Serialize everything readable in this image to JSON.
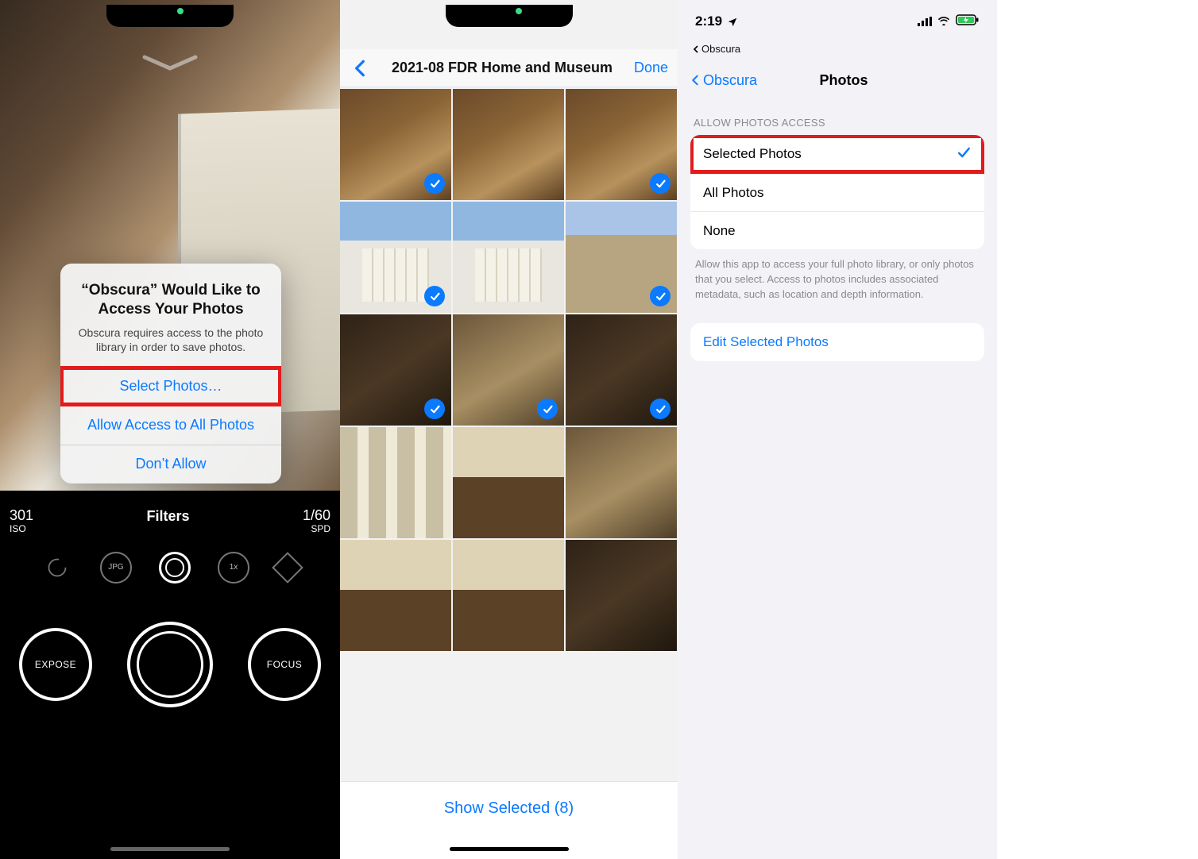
{
  "left": {
    "alert": {
      "title": "“Obscura” Would Like to Access Your Photos",
      "subtitle": "Obscura requires access to the photo library in order to save photos.",
      "buttons": {
        "select": "Select Photos…",
        "allow_all": "Allow Access to All Photos",
        "deny": "Don’t Allow"
      }
    },
    "hud": {
      "iso_value": "301",
      "iso_label": "ISO",
      "center_title": "Filters",
      "spd_value": "1/60",
      "spd_label": "SPD",
      "format_label": "JPG",
      "zoom_label": "1x",
      "expose_label": "EXPOSE",
      "focus_label": "FOCUS"
    }
  },
  "mid": {
    "album_title": "2021-08 FDR Home and Museum",
    "done_label": "Done",
    "show_selected_label": "Show Selected (8)",
    "selected_count": 8,
    "thumbs": [
      {
        "cls": "bronze",
        "selected": true
      },
      {
        "cls": "bronze",
        "selected": false
      },
      {
        "cls": "bronze",
        "selected": true
      },
      {
        "cls": "bldg",
        "selected": true
      },
      {
        "cls": "bldg",
        "selected": false
      },
      {
        "cls": "stone",
        "selected": true
      },
      {
        "cls": "interior-dark",
        "selected": true
      },
      {
        "cls": "interior-warm",
        "selected": true
      },
      {
        "cls": "interior-dark",
        "selected": true
      },
      {
        "cls": "gallery",
        "selected": false
      },
      {
        "cls": "parlor",
        "selected": false
      },
      {
        "cls": "interior-warm",
        "selected": false
      },
      {
        "cls": "parlor",
        "selected": false
      },
      {
        "cls": "parlor",
        "selected": false
      },
      {
        "cls": "interior-dark",
        "selected": false
      }
    ]
  },
  "right": {
    "status": {
      "time": "2:19",
      "back_app": "Obscura"
    },
    "nav": {
      "back_label": "Obscura",
      "title": "Photos"
    },
    "section_label": "ALLOW PHOTOS ACCESS",
    "options": {
      "selected_photos": "Selected Photos",
      "all_photos": "All Photos",
      "none": "None"
    },
    "selected_option": "selected_photos",
    "footer_note": "Allow this app to access your full photo library, or only photos that you select. Access to photos includes associated metadata, such as location and depth information.",
    "edit_label": "Edit Selected Photos"
  }
}
